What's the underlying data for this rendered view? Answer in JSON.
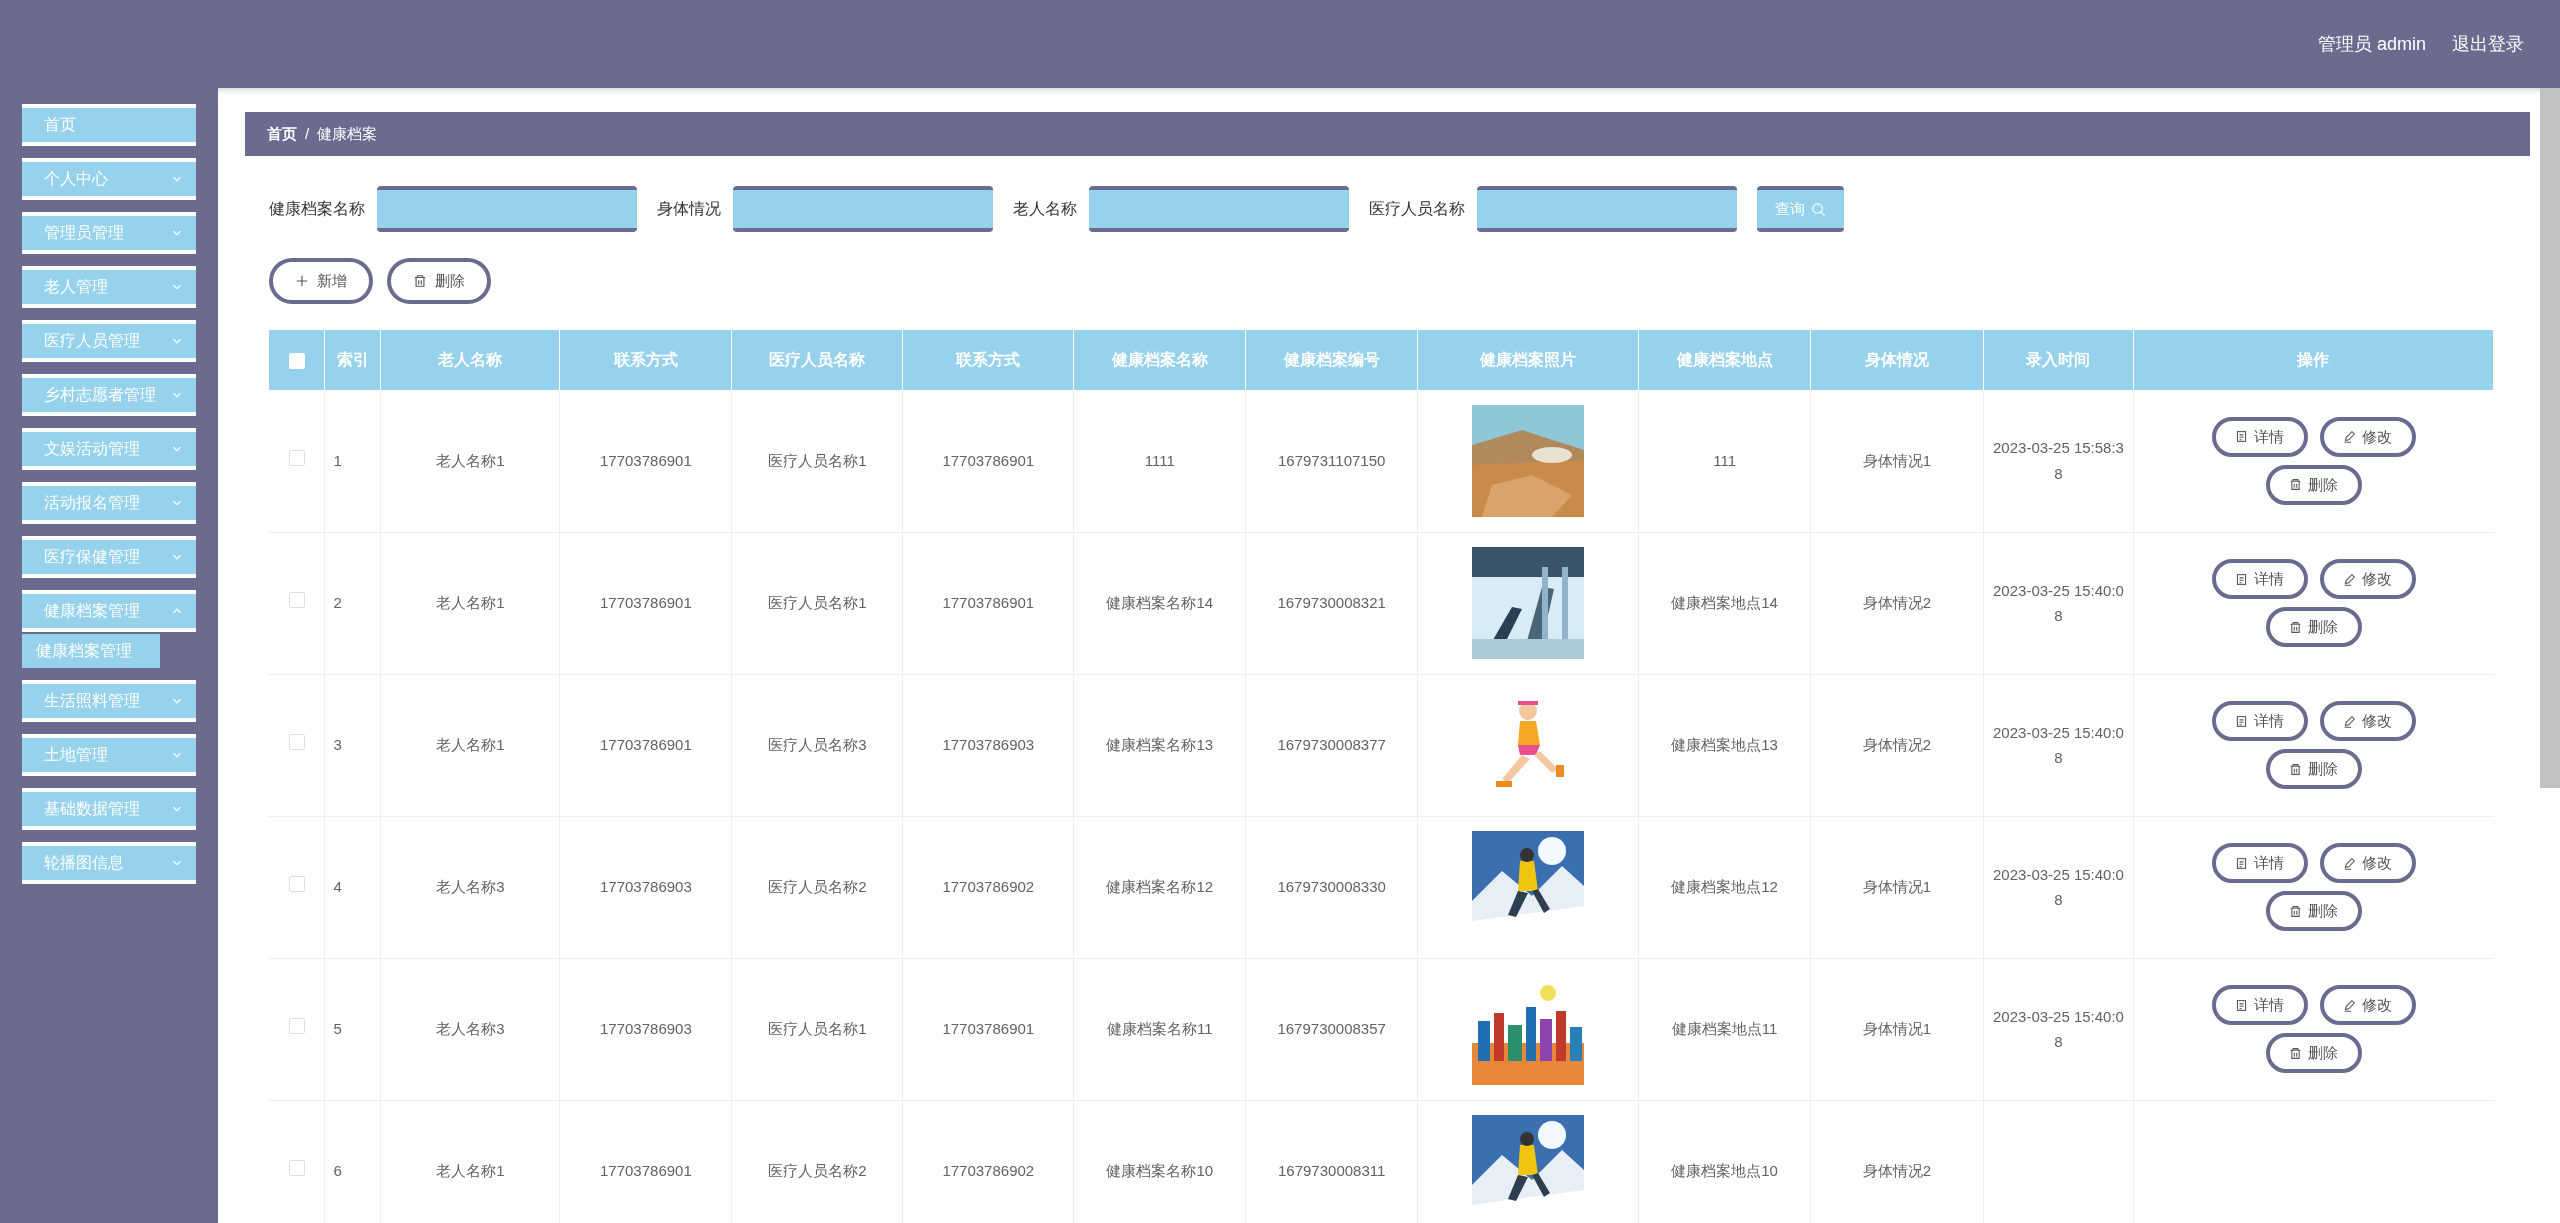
{
  "header": {
    "user": "管理员 admin",
    "logout": "退出登录"
  },
  "sidebar": {
    "items": [
      {
        "label": "首页",
        "kind": "link"
      },
      {
        "label": "个人中心",
        "kind": "menu",
        "expanded": false
      },
      {
        "label": "管理员管理",
        "kind": "menu",
        "expanded": false
      },
      {
        "label": "老人管理",
        "kind": "menu",
        "expanded": false
      },
      {
        "label": "医疗人员管理",
        "kind": "menu",
        "expanded": false
      },
      {
        "label": "乡村志愿者管理",
        "kind": "menu",
        "expanded": false
      },
      {
        "label": "文娱活动管理",
        "kind": "menu",
        "expanded": false
      },
      {
        "label": "活动报名管理",
        "kind": "menu",
        "expanded": false
      },
      {
        "label": "医疗保健管理",
        "kind": "menu",
        "expanded": false
      },
      {
        "label": "健康档案管理",
        "kind": "menu",
        "expanded": true,
        "children": [
          {
            "label": "健康档案管理",
            "selected": true
          }
        ]
      },
      {
        "label": "生活照料管理",
        "kind": "menu",
        "expanded": false
      },
      {
        "label": "土地管理",
        "kind": "menu",
        "expanded": false
      },
      {
        "label": "基础数据管理",
        "kind": "menu",
        "expanded": false
      },
      {
        "label": "轮播图信息",
        "kind": "menu",
        "expanded": false
      }
    ]
  },
  "breadcrumb": [
    "首页",
    "健康档案"
  ],
  "breadcrumb_separator": "/",
  "search": {
    "fields": [
      {
        "label": "健康档案名称"
      },
      {
        "label": "身体情况"
      },
      {
        "label": "老人名称"
      },
      {
        "label": "医疗人员名称"
      }
    ],
    "button": "查询"
  },
  "actions": {
    "add": "新增",
    "delete": "删除"
  },
  "table": {
    "select_all_checked": false,
    "columns": [
      "索引",
      "老人名称",
      "联系方式",
      "医疗人员名称",
      "联系方式",
      "健康档案名称",
      "健康档案编号",
      "健康档案照片",
      "健康档案地点",
      "身体情况",
      "录入时间",
      "操作"
    ],
    "rows": [
      {
        "checked": false,
        "cells": [
          "1",
          "老人名称1",
          "17703786901",
          "医疗人员名称1",
          "17703786901",
          "1111",
          "1679731107150",
          {
            "kind": "picture"
          },
          "111",
          "身体情况1",
          "2023-03-25 15:58:38"
        ],
        "buttons": [
          "详情",
          "修改",
          "删除"
        ]
      },
      {
        "checked": false,
        "cells": [
          "2",
          "老人名称1",
          "17703786901",
          "医疗人员名称1",
          "17703786901",
          "健康档案名称14",
          "1679730008321",
          {
            "kind": "picture"
          },
          "健康档案地点14",
          "身体情况2",
          "2023-03-25 15:40:08"
        ],
        "buttons": [
          "详情",
          "修改",
          "删除"
        ]
      },
      {
        "checked": false,
        "cells": [
          "3",
          "老人名称1",
          "17703786901",
          "医疗人员名称3",
          "17703786903",
          "健康档案名称13",
          "1679730008377",
          {
            "kind": "picture"
          },
          "健康档案地点13",
          "身体情况2",
          "2023-03-25 15:40:08"
        ],
        "buttons": [
          "详情",
          "修改",
          "删除"
        ]
      },
      {
        "checked": false,
        "cells": [
          "4",
          "老人名称3",
          "17703786903",
          "医疗人员名称2",
          "17703786902",
          "健康档案名称12",
          "1679730008330",
          {
            "kind": "picture"
          },
          "健康档案地点12",
          "身体情况1",
          "2023-03-25 15:40:08"
        ],
        "buttons": [
          "详情",
          "修改",
          "删除"
        ]
      },
      {
        "checked": false,
        "cells": [
          "5",
          "老人名称3",
          "17703786903",
          "医疗人员名称1",
          "17703786901",
          "健康档案名称11",
          "1679730008357",
          {
            "kind": "picture"
          },
          "健康档案地点11",
          "身体情况1",
          "2023-03-25 15:40:08"
        ],
        "buttons": [
          "详情",
          "修改",
          "删除"
        ]
      },
      {
        "checked": false,
        "cells": [
          "6",
          "老人名称1",
          "17703786901",
          "医疗人员名称2",
          "17703786902",
          "健康档案名称10",
          "1679730008311",
          {
            "kind": "picture"
          },
          "健康档案地点10",
          "身体情况2"
        ]
      }
    ]
  }
}
